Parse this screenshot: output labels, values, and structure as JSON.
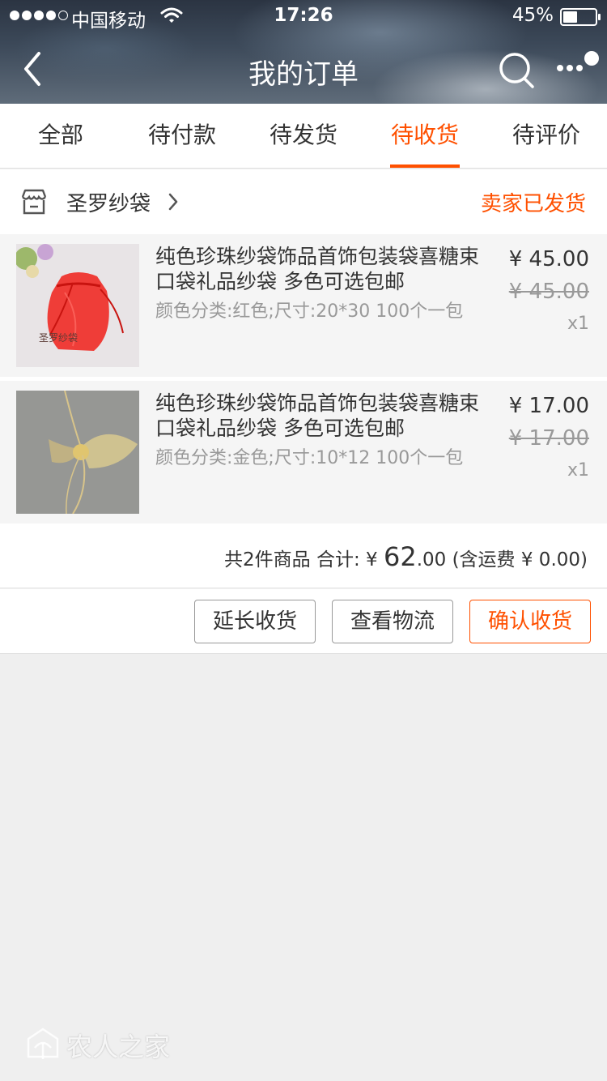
{
  "status_bar": {
    "carrier": "中国移动",
    "time": "17:26",
    "battery_percent": "45%",
    "battery_level": 0.45
  },
  "nav": {
    "title": "我的订单",
    "back_icon": "chevron-left-icon",
    "search_icon": "search-icon",
    "more_icon": "more-dots-icon"
  },
  "tabs": [
    {
      "label": "全部",
      "active": false
    },
    {
      "label": "待付款",
      "active": false
    },
    {
      "label": "待发货",
      "active": false
    },
    {
      "label": "待收货",
      "active": true
    },
    {
      "label": "待评价",
      "active": false
    }
  ],
  "order": {
    "shop_name": "圣罗纱袋",
    "status": "卖家已发货",
    "items": [
      {
        "title": "纯色珍珠纱袋饰品首饰包装袋喜糖束口袋礼品纱袋 多色可选包邮",
        "spec": "颜色分类:红色;尺寸:20*30  100个一包",
        "price": "¥ 45.00",
        "original_price": "¥ 45.00",
        "quantity": "x1",
        "thumb_label": "圣罗纱袋"
      },
      {
        "title": "纯色珍珠纱袋饰品首饰包装袋喜糖束口袋礼品纱袋 多色可选包邮",
        "spec": "颜色分类:金色;尺寸:10*12  100个一包",
        "price": "¥ 17.00",
        "original_price": "¥ 17.00",
        "quantity": "x1"
      }
    ],
    "total": {
      "count_text": "共2件商品 合计: ¥ ",
      "amount_int": "62",
      "amount_dec": ".00",
      "shipping_text": " (含运费 ¥ 0.00)"
    },
    "actions": {
      "extend": "延长收货",
      "logistics": "查看物流",
      "confirm": "确认收货"
    }
  },
  "watermark": "农人之家",
  "colors": {
    "accent": "#ff5000",
    "background": "#efefef"
  }
}
